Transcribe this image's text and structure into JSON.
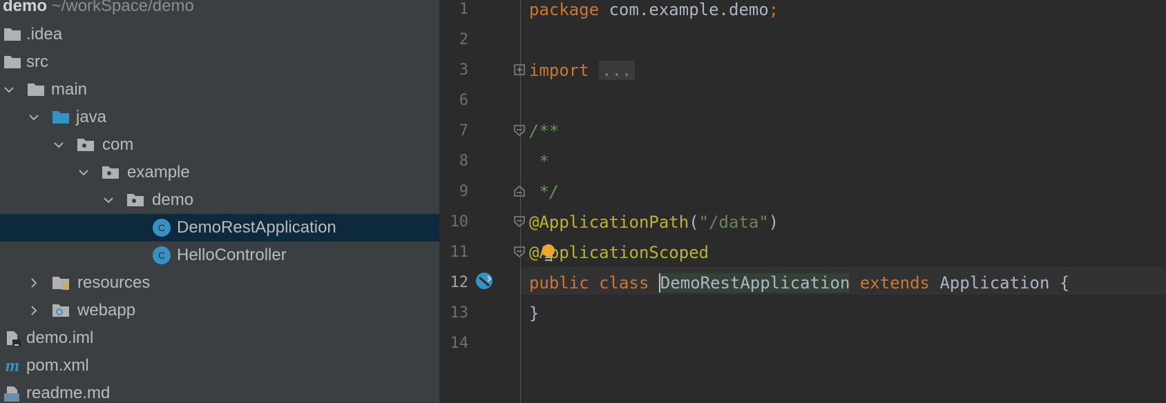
{
  "project_tree": {
    "root": {
      "name": "demo",
      "path": "~/workSpace/demo"
    },
    "items": [
      {
        "label": ".idea",
        "icon": "folder-icon"
      },
      {
        "label": "src",
        "icon": "folder-icon"
      },
      {
        "label": "main",
        "icon": "folder-icon"
      },
      {
        "label": "java",
        "icon": "source-folder-icon"
      },
      {
        "label": "com",
        "icon": "package-icon"
      },
      {
        "label": "example",
        "icon": "package-icon"
      },
      {
        "label": "demo",
        "icon": "package-icon"
      },
      {
        "label": "DemoRestApplication",
        "icon": "java-class-icon"
      },
      {
        "label": "HelloController",
        "icon": "java-class-icon"
      },
      {
        "label": "resources",
        "icon": "resources-folder-icon"
      },
      {
        "label": "webapp",
        "icon": "web-folder-icon"
      },
      {
        "label": "demo.iml",
        "icon": "iml-file-icon"
      },
      {
        "label": "pom.xml",
        "icon": "maven-file-icon"
      },
      {
        "label": "readme.md",
        "icon": "markdown-file-icon"
      }
    ],
    "selected": "DemoRestApplication"
  },
  "editor": {
    "line_numbers": [
      "1",
      "2",
      "3",
      "6",
      "7",
      "8",
      "9",
      "10",
      "11",
      "12",
      "13",
      "14"
    ],
    "current_line": "12",
    "code": {
      "l1_kw": "package",
      "l1_rest": " com.example.demo",
      "l1_semi": ";",
      "l3_kw": "import",
      "l3_collapsed": "...",
      "l7": "/**",
      "l8": " *",
      "l9": " */",
      "l10_ann": "@ApplicationPath",
      "l10_open": "(",
      "l10_str": "\"/data\"",
      "l10_close": ")",
      "l11_at": "@",
      "l11_ann": "ApplicationScoped",
      "l12_public": "public",
      "l12_class": " class ",
      "l12_name": "DemoRestApplication",
      "l12_extends": " extends ",
      "l12_rest": "Application {",
      "l13": "}"
    },
    "colors": {
      "keyword": "#cc7832",
      "doc_comment": "#629755",
      "annotation": "#bbb529",
      "string": "#6a8759"
    }
  }
}
